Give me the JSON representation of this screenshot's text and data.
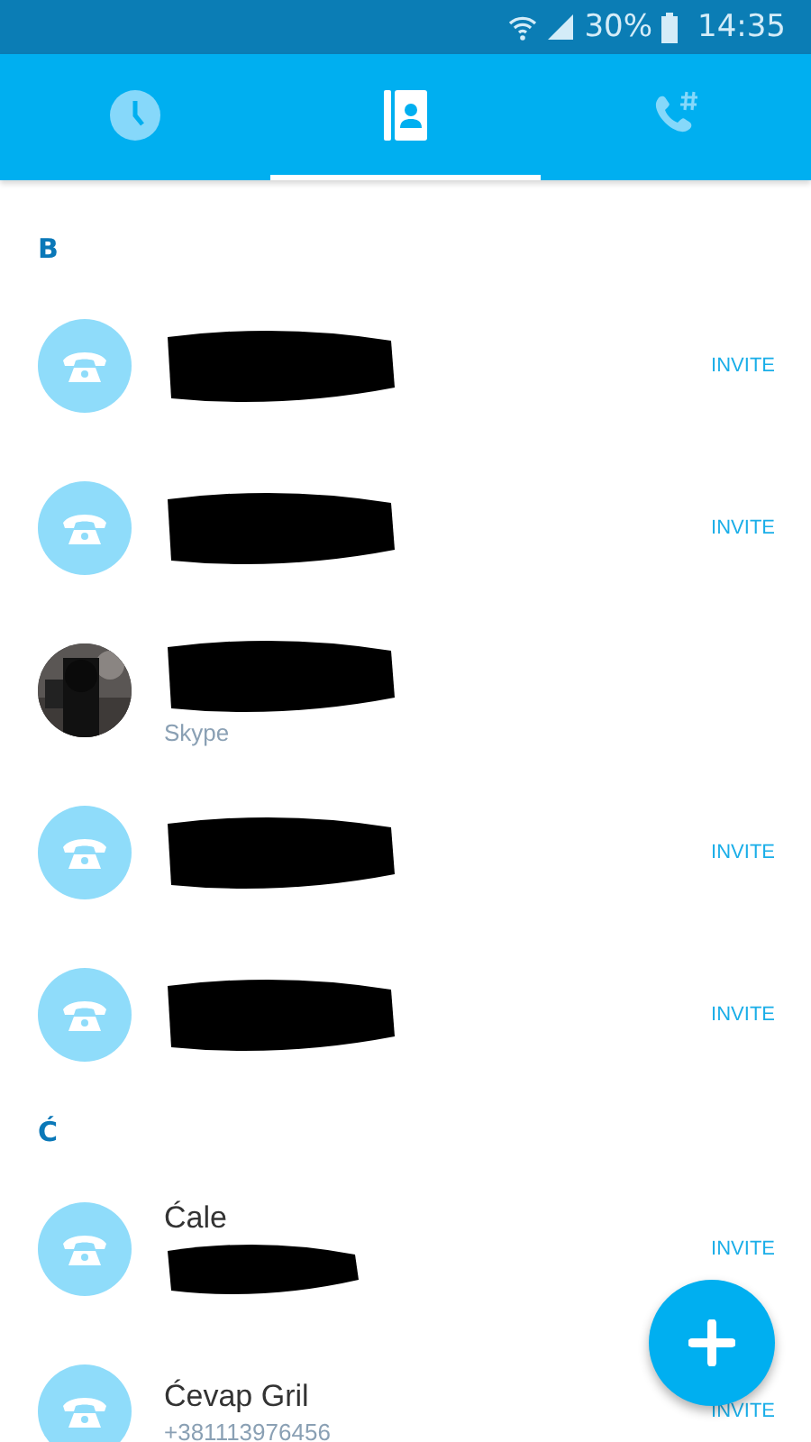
{
  "status_bar": {
    "battery": "30%",
    "time": "14:35"
  },
  "tabs": [
    {
      "kind": "recent",
      "selected": false
    },
    {
      "kind": "contacts",
      "selected": true
    },
    {
      "kind": "dialpad",
      "selected": false
    }
  ],
  "sections": [
    {
      "letter": "B",
      "contacts": [
        {
          "kind": "phone",
          "redacted": true,
          "action": "INVITE"
        },
        {
          "kind": "phone",
          "redacted": true,
          "action": "INVITE"
        },
        {
          "kind": "skype",
          "redacted": true,
          "subtitle": "Skype"
        },
        {
          "kind": "phone",
          "redacted": true,
          "action": "INVITE"
        },
        {
          "kind": "phone",
          "redacted": true,
          "action": "INVITE"
        }
      ]
    },
    {
      "letter": "Ć",
      "contacts": [
        {
          "kind": "phone",
          "name": "Ćale",
          "redacted": true,
          "action": "INVITE"
        },
        {
          "kind": "phone",
          "name": "Ćevap Gril",
          "subtitle": "+381113976456",
          "redacted": false,
          "action": "INVITE"
        }
      ]
    }
  ]
}
